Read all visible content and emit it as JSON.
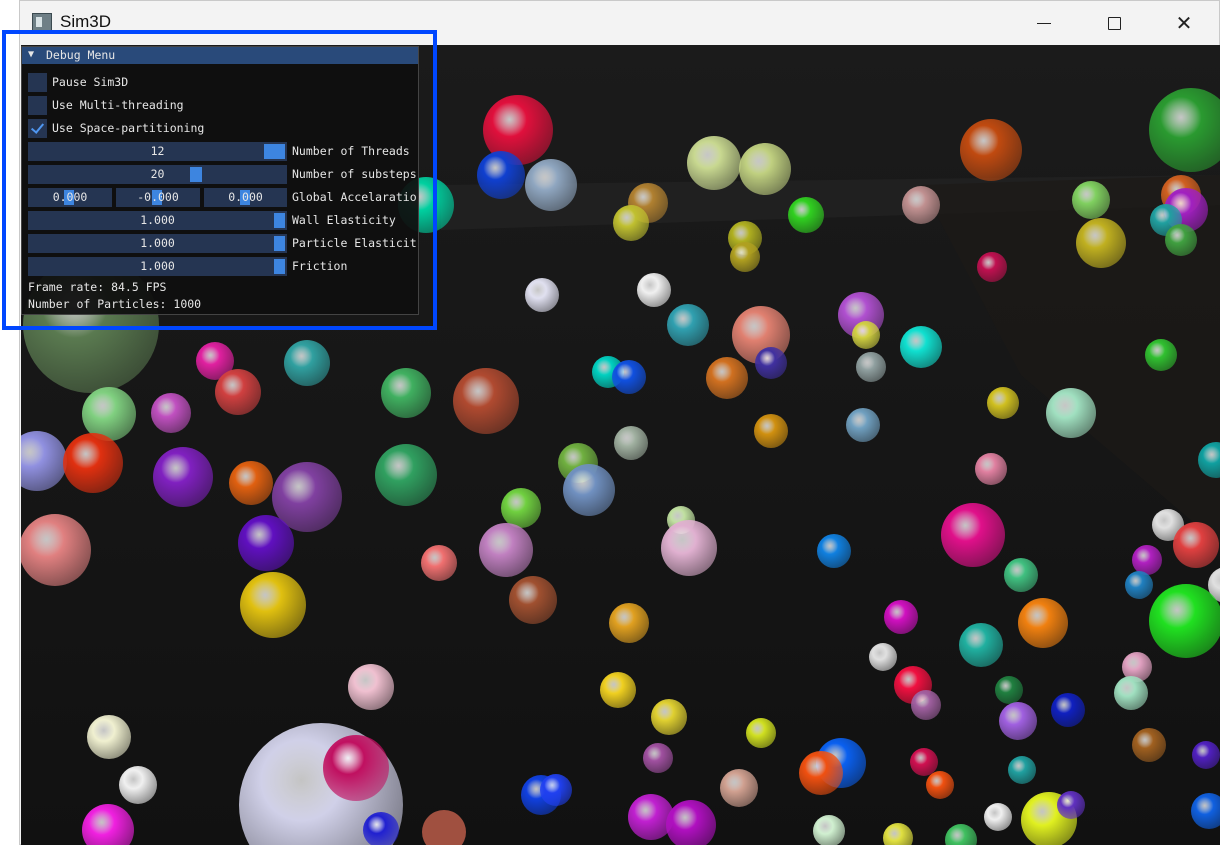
{
  "window": {
    "title": "Sim3D",
    "controls": {
      "minimize_icon": "minimize-icon",
      "maximize_icon": "maximize-icon",
      "close_glyph": "✕"
    }
  },
  "debug_menu": {
    "title": "Debug Menu",
    "collapse_glyph": "▼",
    "checkboxes": [
      {
        "label": "Pause Sim3D",
        "checked": false
      },
      {
        "label": "Use Multi-threading",
        "checked": false
      },
      {
        "label": "Use Space-partitioning",
        "checked": true
      }
    ],
    "threads": {
      "value": "12",
      "label": "Number of Threads"
    },
    "substeps": {
      "value": "20",
      "label": "Number of substeps"
    },
    "acceleration": {
      "x": "0.000",
      "y": "-0.000",
      "z": "0.000",
      "label": "Global Accelaratio"
    },
    "wall_elasticity": {
      "value": "1.000",
      "label": "Wall Elasticity"
    },
    "particle_elasticity": {
      "value": "1.000",
      "label": "Particle Elasticit"
    },
    "friction": {
      "value": "1.000",
      "label": "Friction"
    },
    "frame_rate": "Frame rate: 84.5 FPS",
    "particle_count": "Number of Particles: 1000"
  },
  "colors": {
    "highlight": "#0047ff",
    "imgui_header": "#294a7a",
    "imgui_frame": "#253552",
    "imgui_grab": "#3d85e0",
    "scene_background": "#141414"
  }
}
